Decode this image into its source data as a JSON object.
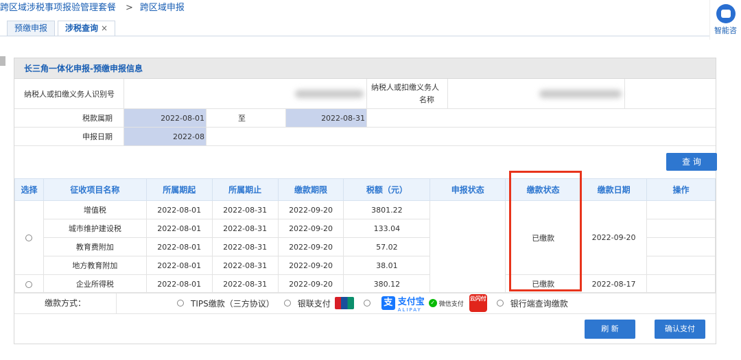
{
  "breadcrumb": {
    "root": "跨区域涉税事项报验管理套餐",
    "sep": ">",
    "current": "跨区域申报"
  },
  "assistant": {
    "label": "智能咨"
  },
  "tabs": [
    {
      "label": "预缴申报",
      "active": false
    },
    {
      "label": "涉税查询",
      "active": true,
      "close": "×"
    }
  ],
  "panel": {
    "title": "长三角一体化申报-预缴申报信息",
    "taxpayer_id_label": "纳税人或扣缴义务人识别号",
    "taxpayer_name_label_1": "纳税人或扣缴义务人",
    "taxpayer_name_label_2": "名称",
    "period_label": "税款属期",
    "period_start": "2022-08-01",
    "period_to": "至",
    "period_end": "2022-08-31",
    "declare_date_label": "申报日期",
    "declare_date": "2022-08",
    "query_button": "查 询"
  },
  "table": {
    "headers": [
      "选择",
      "征收项目名称",
      "所属期起",
      "所属期止",
      "缴款期限",
      "税额（元）",
      "申报状态",
      "缴款状态",
      "缴款日期",
      "操作"
    ],
    "group1": {
      "rows": [
        {
          "name": "增值税",
          "start": "2022-08-01",
          "end": "2022-08-31",
          "deadline": "2022-09-20",
          "amount": "3801.22"
        },
        {
          "name": "城市维护建设税",
          "start": "2022-08-01",
          "end": "2022-08-31",
          "deadline": "2022-09-20",
          "amount": "133.04"
        },
        {
          "name": "教育费附加",
          "start": "2022-08-01",
          "end": "2022-08-31",
          "deadline": "2022-09-20",
          "amount": "57.02"
        },
        {
          "name": "地方教育附加",
          "start": "2022-08-01",
          "end": "2022-08-31",
          "deadline": "2022-09-20",
          "amount": "38.01"
        }
      ],
      "pay_status": "已缴款",
      "pay_date": "2022-09-20"
    },
    "group2": {
      "name": "企业所得税",
      "start": "2022-08-01",
      "end": "2022-08-31",
      "deadline": "2022-09-20",
      "amount": "380.12",
      "pay_status": "已缴款",
      "pay_date": "2022-08-17"
    }
  },
  "payment": {
    "label": "缴款方式：",
    "tips": "TIPS缴款（三方协议）",
    "unionpay": "银联支付",
    "alipay": "支付宝",
    "alipay_sub": "ALIPAY",
    "wechat": "微信支付",
    "cloudpay": "云闪付",
    "bank_query": "银行端查询缴款"
  },
  "buttons": {
    "refresh": "刷 新",
    "confirm": "确认支付"
  },
  "colors": {
    "accent": "#2e77d0",
    "status_red": "#e02020",
    "highlight": "#e8341c"
  }
}
